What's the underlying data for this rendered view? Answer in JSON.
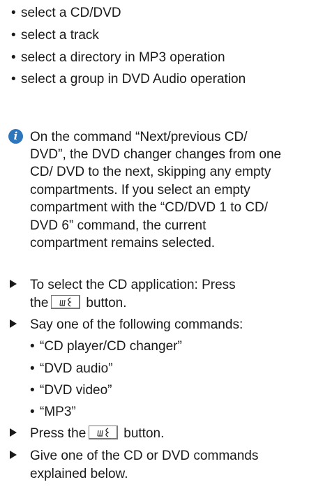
{
  "glyphs": {
    "bullet": "•",
    "info": "i"
  },
  "list1": [
    "select a CD/DVD",
    "select a track",
    "select a directory in MP3 operation",
    "select a group in DVD Audio operation"
  ],
  "note": {
    "icon": "info-icon",
    "icon_color": "#2e77bd",
    "lines": [
      "On the command “Next/previous CD/",
      "DVD”, the DVD changer changes from one",
      "CD/ DVD to the next, skipping any empty",
      "compartments. If you select an empty",
      "compartment with the “CD/DVD 1 to CD/",
      "DVD 6” command, the current",
      "compartment remains selected."
    ]
  },
  "steps": [
    {
      "line1": "To select the CD application: Press",
      "line2_before": "the",
      "line2_after": "button."
    },
    {
      "line1": "Say one of the following commands:",
      "options": [
        "“CD player/CD changer”",
        "“DVD audio”",
        "“DVD video”",
        "“MP3”"
      ]
    },
    {
      "before": "Press the",
      "after": "button."
    },
    {
      "line1": "Give one of the CD or DVD commands",
      "line2": "explained below."
    }
  ]
}
